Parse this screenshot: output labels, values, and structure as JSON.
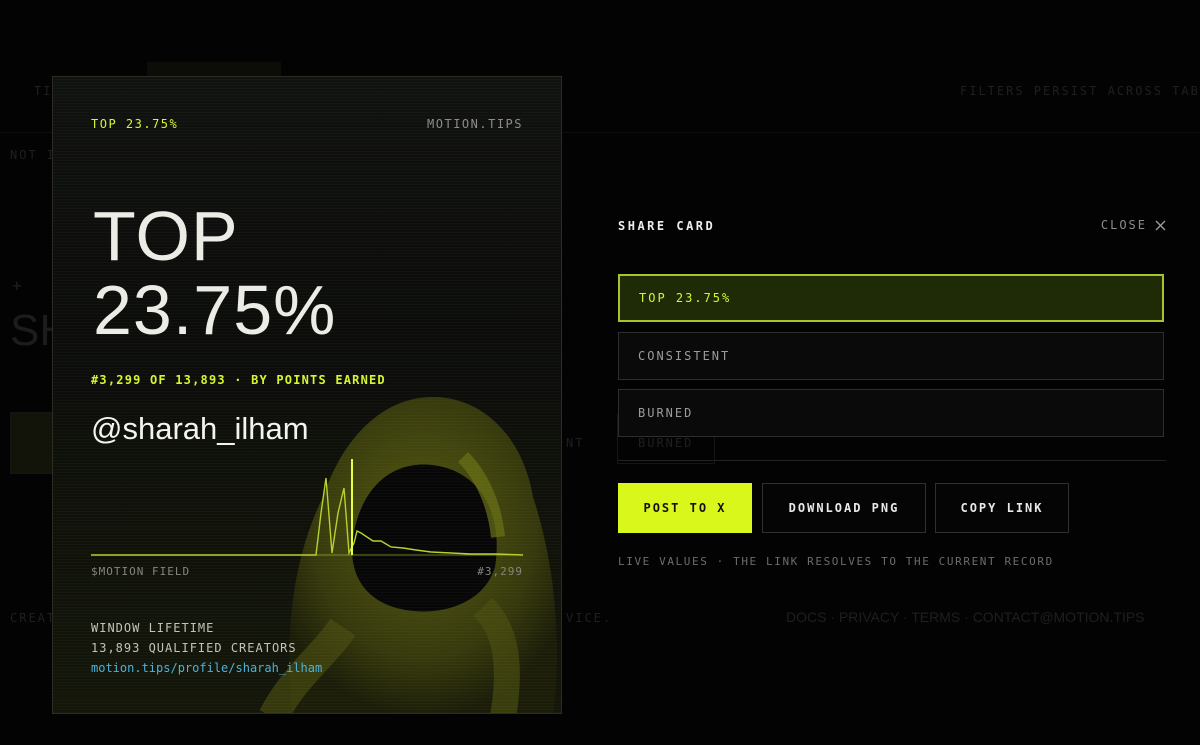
{
  "background": {
    "top_left_tab": "TI",
    "notice": "FILTERS PERSIST ACROSS TABS",
    "sub_text": "NOT I",
    "plus": "+",
    "big_text": "SH",
    "tab_mid": "NT",
    "tab_burned": "BURNED",
    "footer_left": "CREAT",
    "footer_mid": "VICE.",
    "footer_links": "DOCS · PRIVACY · TERMS · CONTACT@MOTION.TIPS"
  },
  "card": {
    "top_tag": "TOP 23.75%",
    "brand": "MOTION.TIPS",
    "hero_line1": "TOP",
    "hero_line2": "23.75%",
    "rank_line": "#3,299 OF 13,893 · BY POINTS EARNED",
    "handle": "@sharah_ilham",
    "field_label": "$MOTION FIELD",
    "field_value": "#3,299",
    "window": "WINDOW LIFETIME",
    "creators": "13,893 QUALIFIED CREATORS",
    "url": "motion.tips/profile/sharah_ilham",
    "accent": "#d6f531",
    "url_color": "#49b3d8"
  },
  "panel": {
    "title": "SHARE CARD",
    "close_label": "CLOSE",
    "close_icon": "close-icon",
    "options": [
      {
        "label": "TOP 23.75%",
        "selected": true
      },
      {
        "label": "CONSISTENT",
        "selected": false
      },
      {
        "label": "BURNED",
        "selected": false
      }
    ],
    "buttons": {
      "post": "POST TO X",
      "download": "DOWNLOAD PNG",
      "copy": "COPY LINK"
    },
    "note": "LIVE VALUES · THE LINK RESOLVES TO THE CURRENT RECORD",
    "primary_color": "#d9f71b"
  }
}
